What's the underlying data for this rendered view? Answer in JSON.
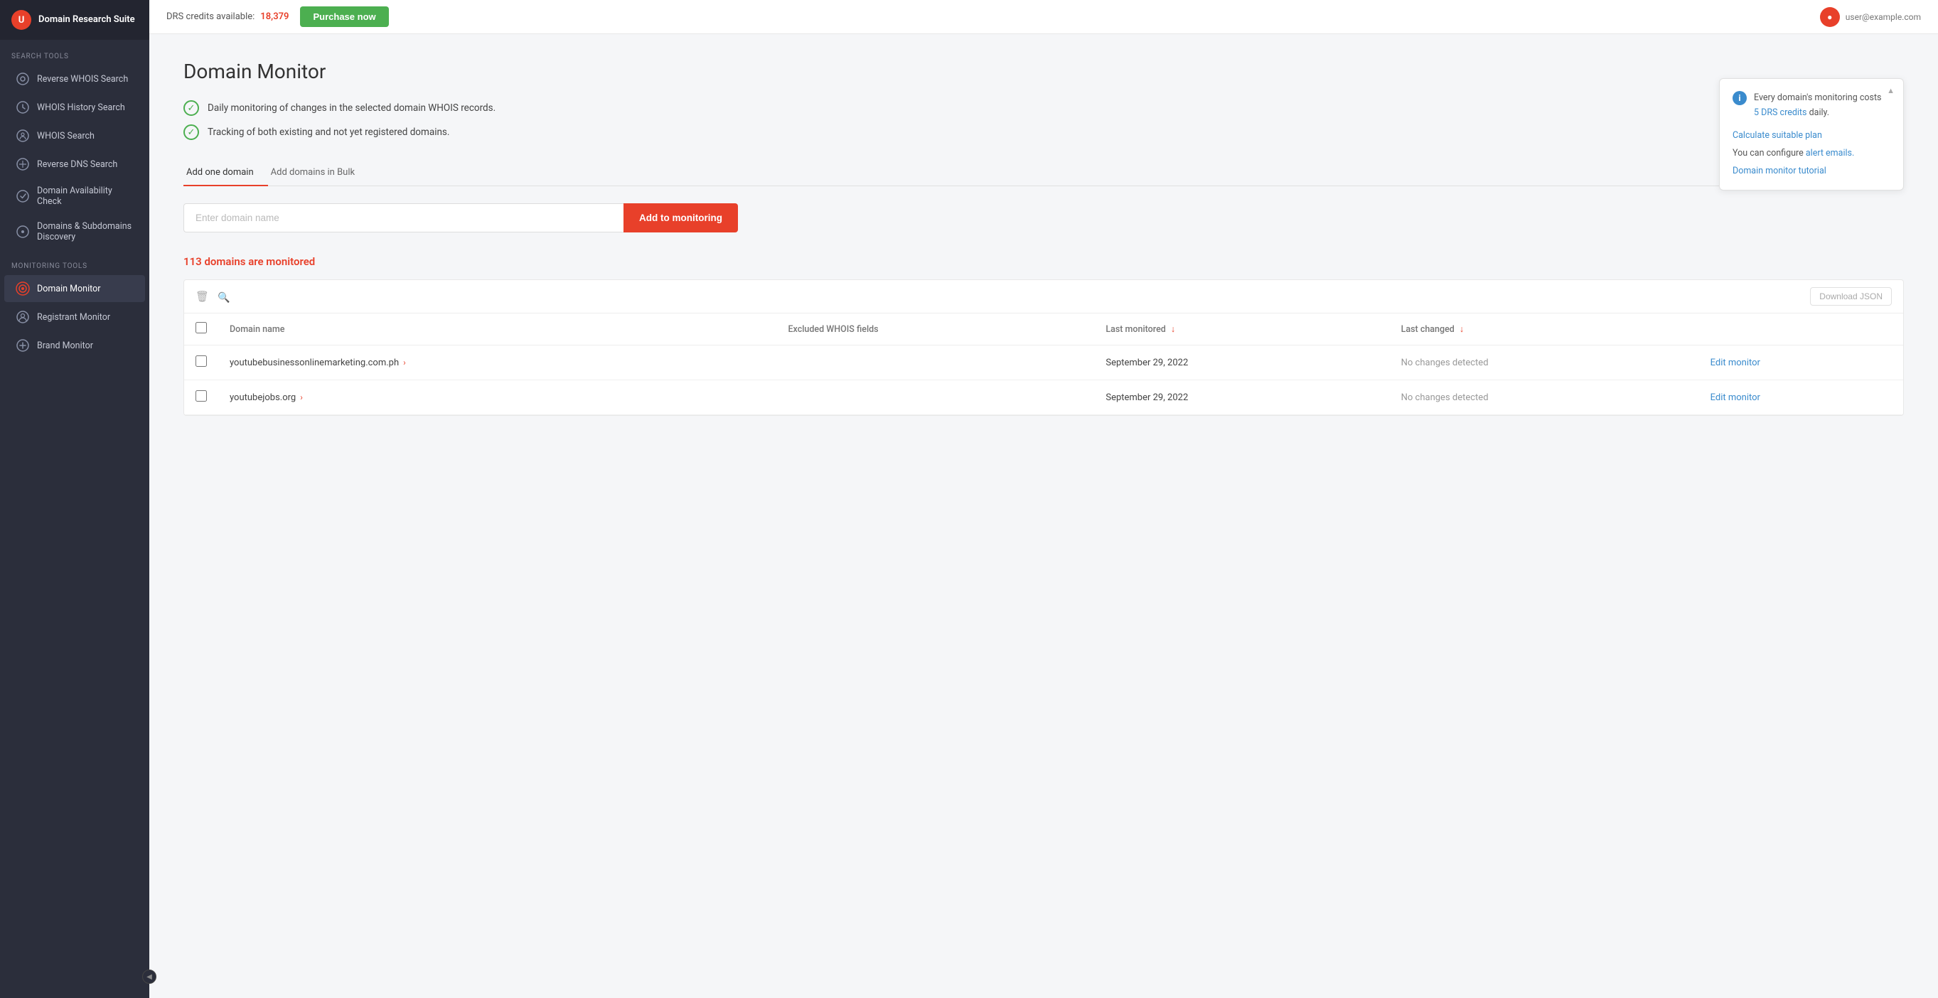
{
  "app": {
    "title": "Domain Research Suite",
    "logo_letter": "U"
  },
  "topbar": {
    "credits_label": "DRS credits available:",
    "credits_count": "18,379",
    "purchase_btn": "Purchase now",
    "user_name": "user@example.com"
  },
  "sidebar": {
    "search_tools_label": "Search tools",
    "monitoring_tools_label": "Monitoring tools",
    "search_items": [
      {
        "id": "reverse-whois",
        "label": "Reverse WHOIS Search"
      },
      {
        "id": "whois-history",
        "label": "WHOIS History Search"
      },
      {
        "id": "whois-search",
        "label": "WHOIS Search"
      },
      {
        "id": "reverse-dns",
        "label": "Reverse DNS Search"
      },
      {
        "id": "domain-availability",
        "label": "Domain Availability Check"
      },
      {
        "id": "domains-subdomains",
        "label": "Domains & Subdomains Discovery"
      }
    ],
    "monitoring_items": [
      {
        "id": "domain-monitor",
        "label": "Domain Monitor",
        "active": true
      },
      {
        "id": "registrant-monitor",
        "label": "Registrant Monitor"
      },
      {
        "id": "brand-monitor",
        "label": "Brand Monitor"
      }
    ]
  },
  "page": {
    "title": "Domain Monitor",
    "features": [
      "Daily monitoring of changes in the selected domain WHOIS records.",
      "Tracking of both existing and not yet registered domains."
    ],
    "tabs": [
      {
        "id": "add-one",
        "label": "Add one domain",
        "active": true
      },
      {
        "id": "add-bulk",
        "label": "Add domains in Bulk",
        "active": false
      }
    ],
    "input_placeholder": "Enter domain name",
    "add_btn": "Add to monitoring",
    "monitored_count": "113",
    "monitored_label": "domains are monitored",
    "download_btn": "Download JSON",
    "table": {
      "columns": [
        {
          "id": "domain-name",
          "label": "Domain name",
          "sortable": false
        },
        {
          "id": "excluded-whois",
          "label": "Excluded WHOIS fields",
          "sortable": false
        },
        {
          "id": "last-monitored",
          "label": "Last monitored",
          "sortable": true
        },
        {
          "id": "last-changed",
          "label": "Last changed",
          "sortable": true
        }
      ],
      "rows": [
        {
          "domain": "youtubebusinessonlinemarketing.com.ph",
          "excluded_fields": "",
          "last_monitored": "September 29, 2022",
          "last_changed": "No changes detected",
          "edit_label": "Edit monitor"
        },
        {
          "domain": "youtubejobs.org",
          "excluded_fields": "",
          "last_monitored": "September 29, 2022",
          "last_changed": "No changes detected",
          "edit_label": "Edit monitor"
        }
      ]
    }
  },
  "info_panel": {
    "text1": "Every domain's monitoring costs",
    "credits": "5 DRS credits",
    "text2": "daily.",
    "calculate_label": "Calculate suitable plan",
    "configure_label": "You can configure",
    "alert_emails_label": "alert emails.",
    "tutorial_label": "Domain monitor tutorial"
  }
}
